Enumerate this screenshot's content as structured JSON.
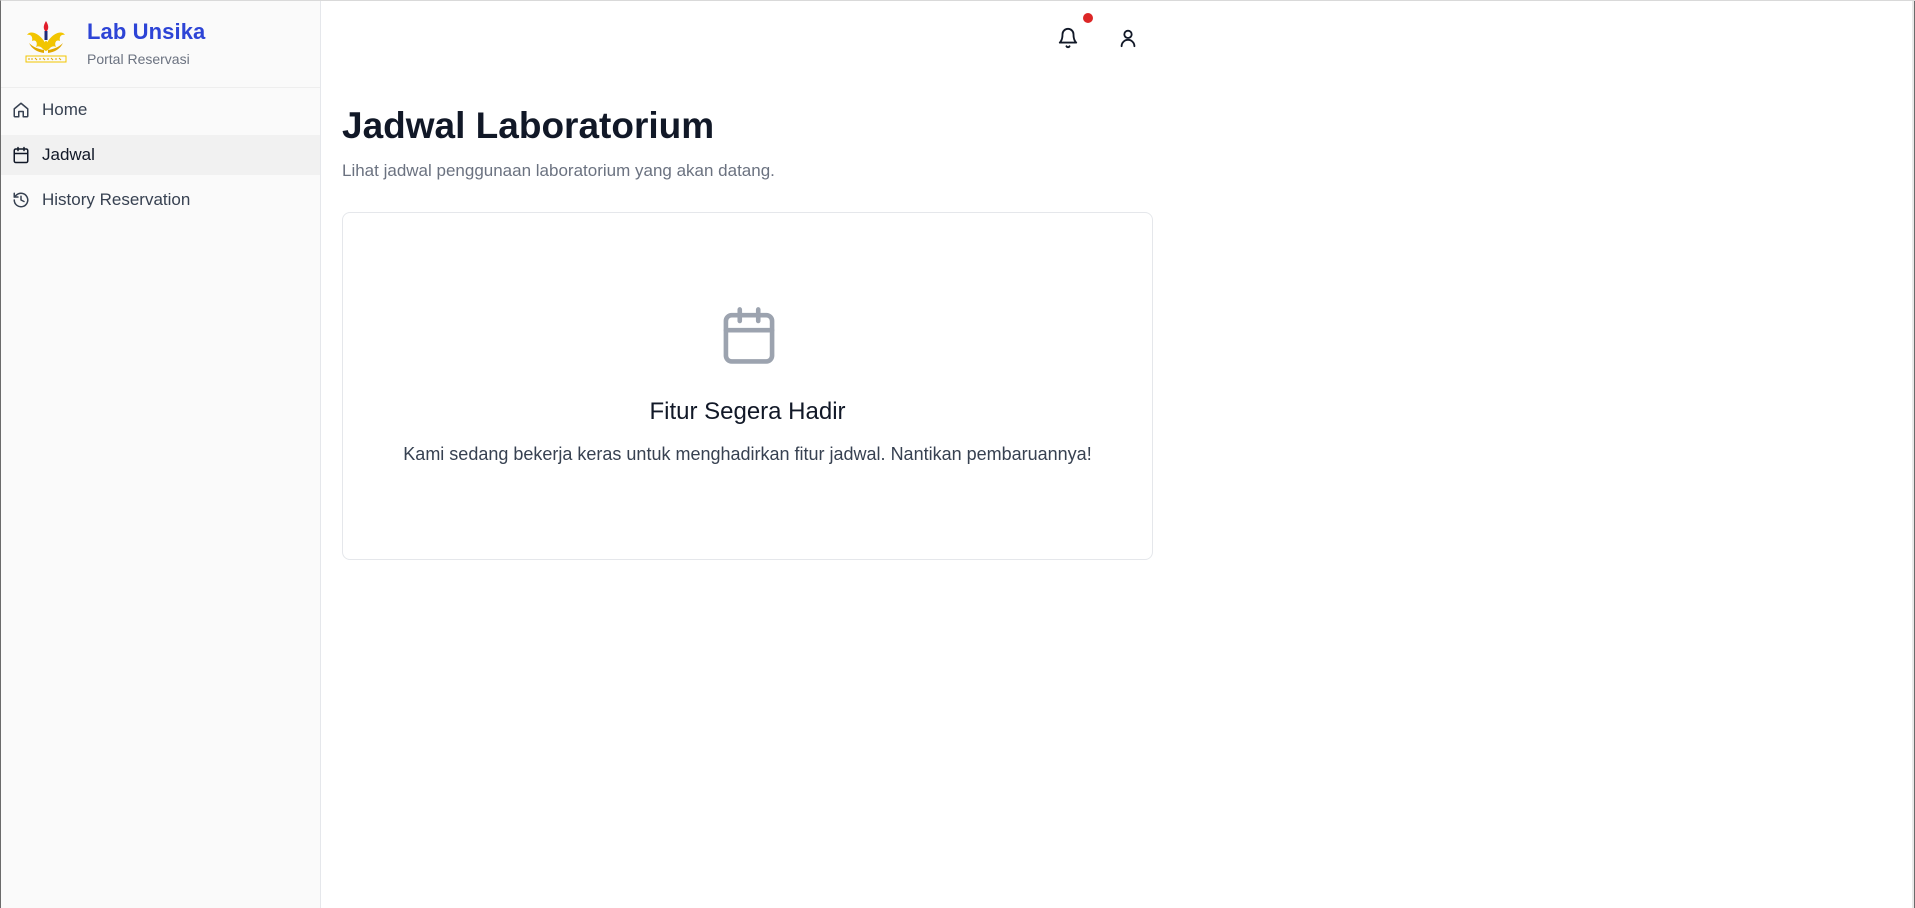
{
  "sidebar": {
    "brand_title": "Lab Unsika",
    "brand_subtitle": "Portal Reservasi",
    "items": [
      {
        "label": "Home",
        "icon": "home-icon",
        "active": false
      },
      {
        "label": "Jadwal",
        "icon": "calendar-icon",
        "active": true
      },
      {
        "label": "History Reservation",
        "icon": "history-icon",
        "active": false
      }
    ]
  },
  "header": {
    "notification_icon": "bell-icon",
    "notification_dot_color": "#dc2626",
    "user_icon": "user-icon"
  },
  "main": {
    "title": "Jadwal Laboratorium",
    "subtitle": "Lihat jadwal penggunaan laboratorium yang akan datang.",
    "card": {
      "icon": "calendar-icon",
      "title": "Fitur Segera Hadir",
      "text": "Kami sedang bekerja keras untuk menghadirkan fitur jadwal. Nantikan pembaruannya!"
    }
  },
  "colors": {
    "brand": "#2d44d6",
    "sidebar_bg": "#fafafa",
    "active_item_bg": "#f1f1f1",
    "muted_icon": "#9ca3af"
  }
}
